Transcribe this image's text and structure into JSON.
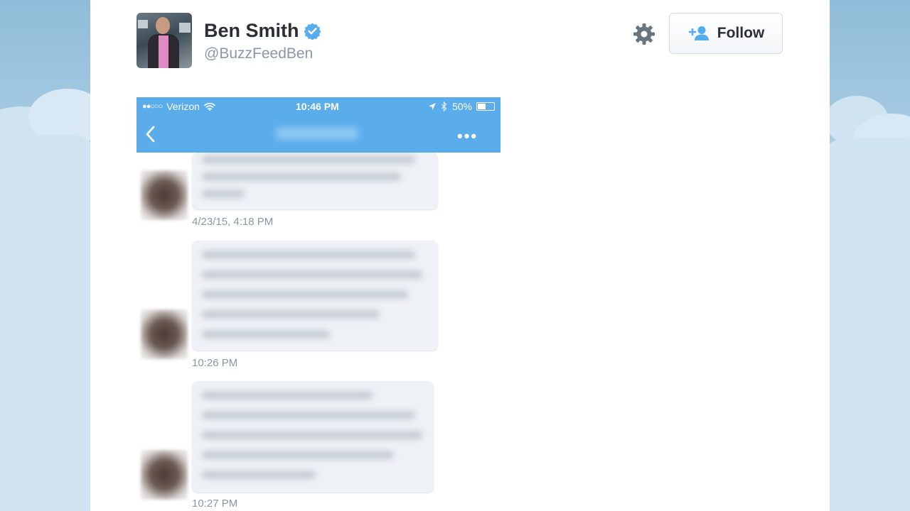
{
  "profile": {
    "name": "Ben Smith",
    "handle": "@BuzzFeedBen",
    "verified": true
  },
  "actions": {
    "follow_label": "Follow"
  },
  "phone_screenshot": {
    "status_bar": {
      "carrier": "Verizon",
      "signal_dots": "●●○○○",
      "time": "10:46 PM",
      "battery": "50%",
      "battery_level": 0.5
    },
    "nav": {
      "more_glyph": "•••"
    },
    "messages": [
      {
        "timestamp": "4/23/15, 4:18 PM"
      },
      {
        "timestamp": "10:26 PM"
      },
      {
        "timestamp": "10:27 PM"
      }
    ]
  },
  "colors": {
    "phone_bar": "#5aaceb",
    "verified_badge": "#55acee",
    "follow_icon": "#55acee",
    "muted_text": "#8899a6"
  },
  "icons": [
    "verified-badge-icon",
    "gear-icon",
    "add-user-icon",
    "wifi-icon",
    "location-arrow-icon",
    "bluetooth-icon",
    "battery-icon",
    "back-chevron-icon"
  ]
}
